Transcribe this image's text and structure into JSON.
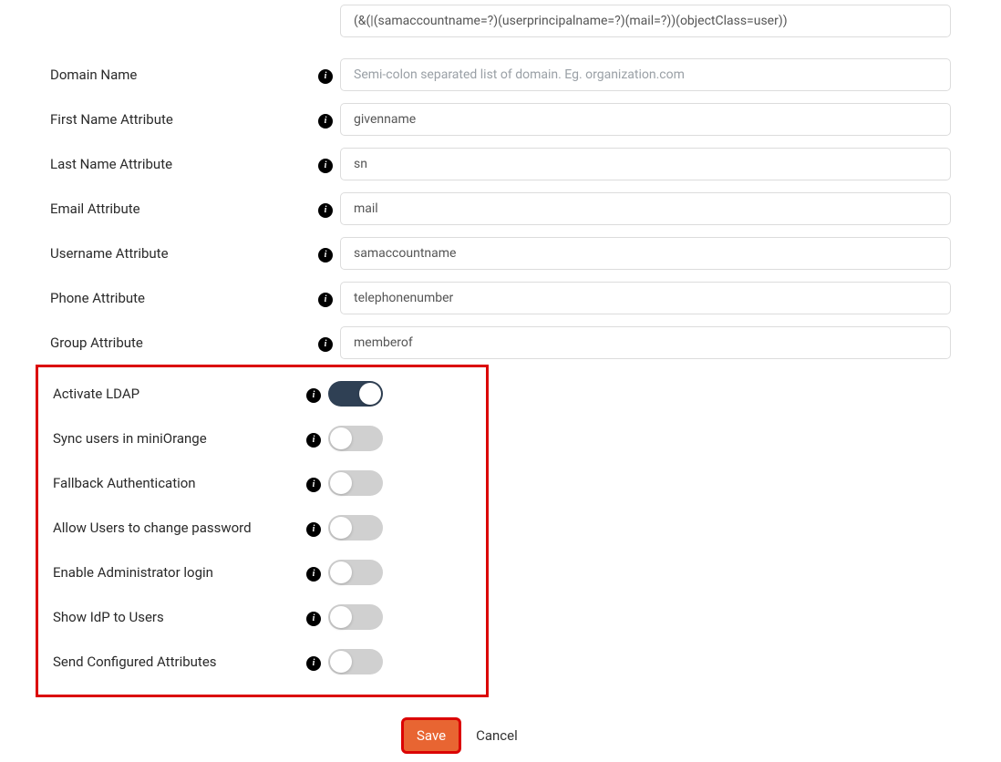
{
  "fields": {
    "search_filter": {
      "value": "(&(|(samaccountname=?)(userprincipalname=?)(mail=?))(objectClass=user))"
    },
    "domain_name": {
      "label": "Domain Name",
      "placeholder": "Semi-colon separated list of domain. Eg. organization.com",
      "value": ""
    },
    "first_name_attr": {
      "label": "First Name Attribute",
      "value": "givenname"
    },
    "last_name_attr": {
      "label": "Last Name Attribute",
      "value": "sn"
    },
    "email_attr": {
      "label": "Email Attribute",
      "value": "mail"
    },
    "username_attr": {
      "label": "Username Attribute",
      "value": "samaccountname"
    },
    "phone_attr": {
      "label": "Phone Attribute",
      "value": "telephonenumber"
    },
    "group_attr": {
      "label": "Group Attribute",
      "value": "memberof"
    }
  },
  "toggles": {
    "activate_ldap": {
      "label": "Activate LDAP",
      "on": true
    },
    "sync_users": {
      "label": "Sync users in miniOrange",
      "on": false
    },
    "fallback_auth": {
      "label": "Fallback Authentication",
      "on": false
    },
    "allow_pwd_change": {
      "label": "Allow Users to change password",
      "on": false
    },
    "enable_admin_login": {
      "label": "Enable Administrator login",
      "on": false
    },
    "show_idp": {
      "label": "Show IdP to Users",
      "on": false
    },
    "send_configured_attrs": {
      "label": "Send Configured Attributes",
      "on": false
    }
  },
  "buttons": {
    "save": "Save",
    "cancel": "Cancel"
  },
  "info_glyph": "i"
}
